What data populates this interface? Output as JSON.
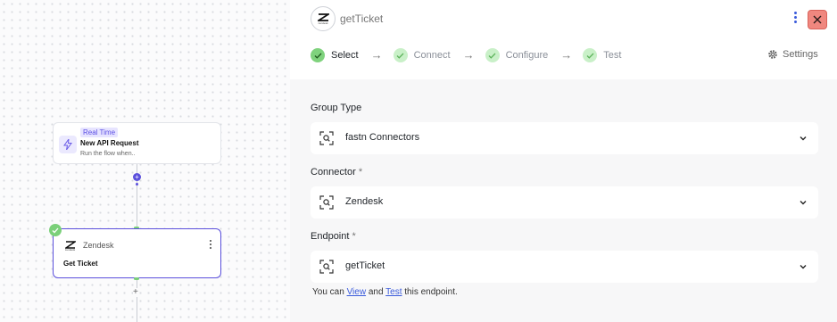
{
  "canvas": {
    "trigger": {
      "tag": "Real Time",
      "title": "New API Request",
      "subtitle": "Run the flow when.."
    },
    "action": {
      "app": "Zendesk",
      "operation": "Get Ticket"
    },
    "connector_plus": "+",
    "add_plus": "+"
  },
  "panel": {
    "title": "getTicket",
    "steps": [
      {
        "label": "Select"
      },
      {
        "label": "Connect"
      },
      {
        "label": "Configure"
      },
      {
        "label": "Test"
      }
    ],
    "arrow": "→",
    "settings_label": "Settings",
    "fields": [
      {
        "label": "Group Type",
        "required": "",
        "value": "fastn Connectors"
      },
      {
        "label": "Connector",
        "required": "*",
        "value": "Zendesk"
      },
      {
        "label": "Endpoint",
        "required": "*",
        "value": "getTicket"
      }
    ],
    "hint": {
      "prefix": "You can",
      "view": "View",
      "and": "and",
      "test": "Test",
      "suffix": "this endpoint."
    },
    "logo_caption": "zendesk"
  },
  "colors": {
    "accent": "#5b50dc",
    "success": "#7fd27d",
    "close_bg": "#f0877f",
    "link": "#3b5bdb"
  },
  "icons": {
    "trigger": "lightning-icon",
    "app_logo": "zendesk-logo-icon",
    "close": "close-icon",
    "settings": "gear-icon",
    "field": "search-scan-icon",
    "chevron": "chevron-down-icon",
    "step": "check-icon",
    "menu": "kebab-icon"
  }
}
